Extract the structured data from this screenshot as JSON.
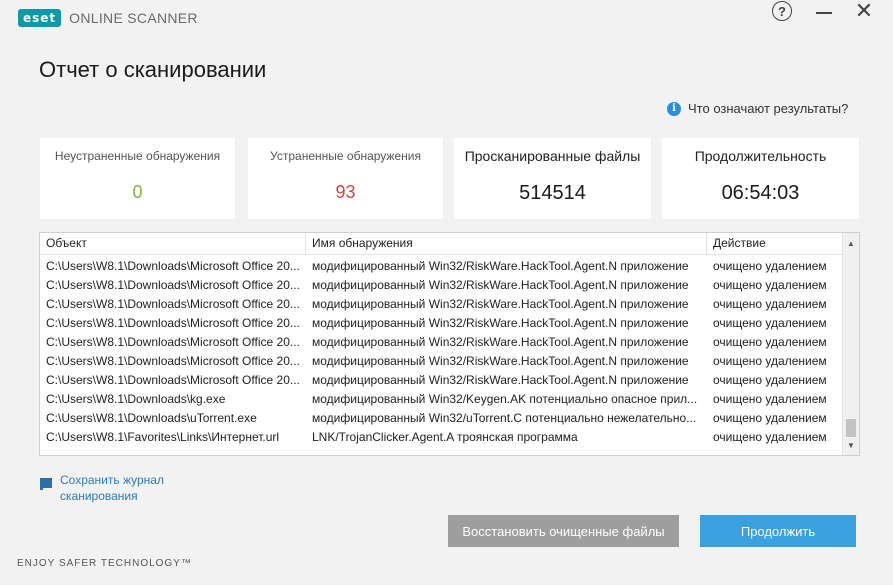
{
  "app": {
    "brand": "eset",
    "product": "ONLINE SCANNER"
  },
  "window_controls": {
    "help_icon": "question-circle-icon",
    "minimize_icon": "minimize-icon",
    "close_icon": "close-icon",
    "help_glyph": "?",
    "close_glyph": "✕"
  },
  "page": {
    "title": "Отчет о сканировании"
  },
  "results_help": {
    "icon_glyph": "i",
    "label": "Что означают результаты?"
  },
  "stats": [
    {
      "label": "Неустраненные обнаружения",
      "value": "0",
      "color": "#7cb342"
    },
    {
      "label": "Устраненные обнаружения",
      "value": "93",
      "color": "#d84343"
    },
    {
      "label": "Просканированные файлы",
      "value": "514514"
    },
    {
      "label": "Продолжительность",
      "value": "06:54:03"
    }
  ],
  "table": {
    "columns": [
      "Объект",
      "Имя обнаружения",
      "Действие"
    ],
    "rows": [
      [
        "C:\\Users\\W8.1\\Downloads\\Microsoft Office 20...",
        "модифицированный Win32/RiskWare.HackTool.Agent.N приложение",
        "очищено удалением"
      ],
      [
        "C:\\Users\\W8.1\\Downloads\\Microsoft Office 20...",
        "модифицированный Win32/RiskWare.HackTool.Agent.N приложение",
        "очищено удалением"
      ],
      [
        "C:\\Users\\W8.1\\Downloads\\Microsoft Office 20...",
        "модифицированный Win32/RiskWare.HackTool.Agent.N приложение",
        "очищено удалением"
      ],
      [
        "C:\\Users\\W8.1\\Downloads\\Microsoft Office 20...",
        "модифицированный Win32/RiskWare.HackTool.Agent.N приложение",
        "очищено удалением"
      ],
      [
        "C:\\Users\\W8.1\\Downloads\\Microsoft Office 20...",
        "модифицированный Win32/RiskWare.HackTool.Agent.N приложение",
        "очищено удалением"
      ],
      [
        "C:\\Users\\W8.1\\Downloads\\Microsoft Office 20...",
        "модифицированный Win32/RiskWare.HackTool.Agent.N приложение",
        "очищено удалением"
      ],
      [
        "C:\\Users\\W8.1\\Downloads\\Microsoft Office 20...",
        "модифицированный Win32/RiskWare.HackTool.Agent.N приложение",
        "очищено удалением"
      ],
      [
        "C:\\Users\\W8.1\\Downloads\\kg.exe",
        "модифицированный Win32/Keygen.AK потенциально опасное прил...",
        "очищено удалением"
      ],
      [
        "C:\\Users\\W8.1\\Downloads\\uTorrent.exe",
        "модифицированный Win32/uTorrent.C потенциально нежелательно...",
        "очищено удалением"
      ],
      [
        "C:\\Users\\W8.1\\Favorites\\Links\\Интернет.url",
        "LNK/TrojanClicker.Agent.A троянская программа",
        "очищено удалением"
      ]
    ]
  },
  "scrollbar": {
    "up_glyph": "▲",
    "down_glyph": "▼"
  },
  "save_log": {
    "label": "Сохранить журнал сканирования"
  },
  "buttons": {
    "restore": "Восстановить очищенные файлы",
    "continue": "Продолжить"
  },
  "footer": {
    "tagline": "ENJOY SAFER TECHNOLOGY™"
  }
}
